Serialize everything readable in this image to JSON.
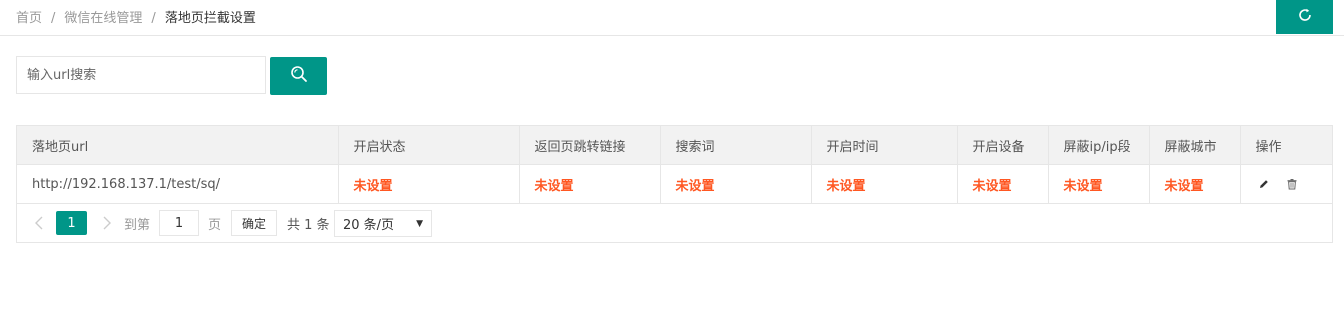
{
  "breadcrumb": {
    "home": "首页",
    "section": "微信在线管理",
    "current": "落地页拦截设置",
    "separator": "/"
  },
  "search": {
    "placeholder": "输入url搜索",
    "value": ""
  },
  "colors": {
    "accent": "#009688",
    "warning_text": "#ff5722"
  },
  "icons": {
    "refresh": "refresh-icon",
    "search": "search-icon",
    "edit": "pencil-icon",
    "delete": "trash-icon",
    "prev": "chevron-left-icon",
    "next": "chevron-right-icon"
  },
  "table": {
    "headers": [
      "落地页url",
      "开启状态",
      "返回页跳转链接",
      "搜索词",
      "开启时间",
      "开启设备",
      "屏蔽ip/ip段",
      "屏蔽城市",
      "操作"
    ],
    "rows": [
      {
        "url": "http://192.168.137.1/test/sq/",
        "status": "未设置",
        "return_link": "未设置",
        "keyword": "未设置",
        "open_time": "未设置",
        "device": "未设置",
        "blocked_ip": "未设置",
        "blocked_city": "未设置"
      }
    ]
  },
  "pagination": {
    "current_page": "1",
    "goto_label": "到第",
    "goto_value": "1",
    "page_label": "页",
    "confirm_label": "确定",
    "total_label": "共 1 条",
    "page_size_label": "20 条/页"
  }
}
